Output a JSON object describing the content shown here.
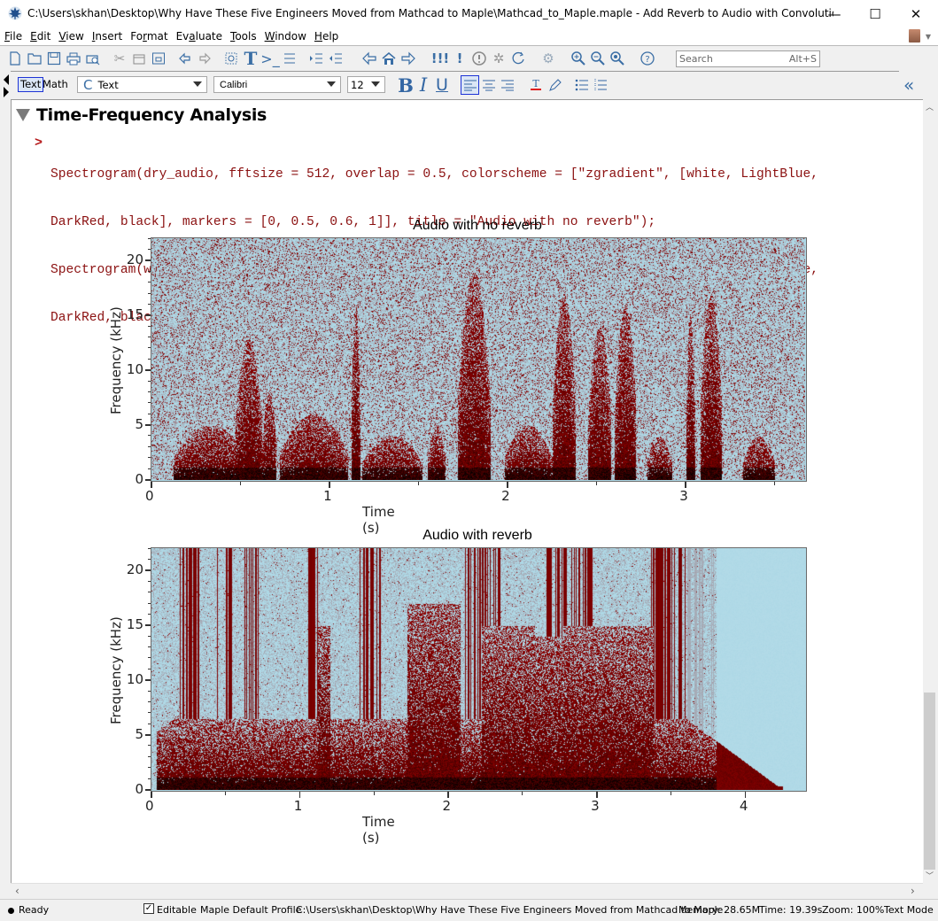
{
  "window": {
    "title": "C:\\Users\\skhan\\Desktop\\Why Have These Five Engineers Moved from Mathcad to Maple\\Mathcad_to_Maple.maple - Add Reverb to Audio with Convolution* - [Server...",
    "minimize": "—",
    "maximize": "☐",
    "close": "✕"
  },
  "menu": [
    {
      "label": "File",
      "mnemonic": "F",
      "rest": "ile"
    },
    {
      "label": "Edit",
      "mnemonic": "E",
      "rest": "dit"
    },
    {
      "label": "View",
      "mnemonic": "V",
      "rest": "iew"
    },
    {
      "label": "Insert",
      "mnemonic": "I",
      "rest": "nsert"
    },
    {
      "label": "Format",
      "pre": "Fo",
      "mnemonic": "r",
      "rest": "mat"
    },
    {
      "label": "Evaluate",
      "pre": "Ev",
      "mnemonic": "a",
      "rest": "luate"
    },
    {
      "label": "Tools",
      "mnemonic": "T",
      "rest": "ools"
    },
    {
      "label": "Window",
      "mnemonic": "W",
      "rest": "indow"
    },
    {
      "label": "Help",
      "mnemonic": "H",
      "rest": "elp"
    }
  ],
  "toolbar": {
    "search_placeholder": "Search",
    "search_shortcut": "Alt+S",
    "icons": [
      "new-document-icon",
      "open-folder-icon",
      "save-icon",
      "print-icon",
      "print-preview-icon",
      "cut-icon",
      "copy-icon",
      "paste-icon",
      "undo-icon",
      "redo-icon",
      "insert-math-icon",
      "insert-text-icon",
      "insert-prompt-icon",
      "insert-paragraph-icon",
      "indent-icon",
      "outdent-icon",
      "back-icon",
      "home-icon",
      "forward-icon",
      "execute-all-icon",
      "execute-icon",
      "interrupt-icon",
      "debug-icon",
      "restart-icon",
      "connect-icon",
      "zoom-in-icon",
      "zoom-out-icon",
      "zoom-fit-icon",
      "help-icon"
    ]
  },
  "format_bar": {
    "mode_text": "Text",
    "mode_math": "Math",
    "style_icon": "C",
    "style_value": "Text",
    "font_value": "Calibri",
    "size_value": "12",
    "bold": "B",
    "italic": "I",
    "underline": "U",
    "collapse": "«"
  },
  "document": {
    "section_title": "Time-Frequency Analysis",
    "prompt": ">",
    "code_lines": [
      "Spectrogram(dry_audio, fftsize = 512, overlap = 0.5, colorscheme = [\"zgradient\", [white, LightBlue,",
      "DarkRed, black], markers = [0, 0.5, 0.6, 1]], title = \"Audio with no reverb\");",
      "Spectrogram(wet_audio, fftsize = 512, overlap = 0.5, colorscheme = [\"zgradient\", [white, LightBlue,",
      "DarkRed, black], markers = [0, 0.5, 0.6, 1]], title = \"Audio with reverb\");"
    ]
  },
  "chart_data": [
    {
      "type": "heatmap",
      "title": "Audio with no reverb",
      "xlabel": "Time (s)",
      "ylabel": "Frequency (kHz)",
      "xlim": [
        0,
        3.67
      ],
      "ylim": [
        0,
        22.05
      ],
      "xticks": [
        0,
        1,
        2,
        3
      ],
      "yticks": [
        0,
        5,
        10,
        15,
        20
      ],
      "colorscheme": {
        "colors": [
          "#ffffff",
          "#add8e6",
          "#8b0000",
          "#000000"
        ],
        "markers": [
          0,
          0.5,
          0.6,
          1
        ]
      },
      "events": [
        {
          "t": [
            0.12,
            0.55
          ],
          "fmax": 5
        },
        {
          "t": [
            0.47,
            0.62
          ],
          "fmax": 13
        },
        {
          "t": [
            0.62,
            0.7
          ],
          "fmax": 8
        },
        {
          "t": [
            0.72,
            1.1
          ],
          "fmax": 6
        },
        {
          "t": [
            1.12,
            1.17
          ],
          "fmax": 16
        },
        {
          "t": [
            1.18,
            1.52
          ],
          "fmax": 4
        },
        {
          "t": [
            1.55,
            1.65
          ],
          "fmax": 5
        },
        {
          "t": [
            1.72,
            1.9
          ],
          "fmax": 19
        },
        {
          "t": [
            1.98,
            2.25
          ],
          "fmax": 5
        },
        {
          "t": [
            2.25,
            2.38
          ],
          "fmax": 17
        },
        {
          "t": [
            2.45,
            2.58
          ],
          "fmax": 14
        },
        {
          "t": [
            2.6,
            2.72
          ],
          "fmax": 16
        },
        {
          "t": [
            2.78,
            2.92
          ],
          "fmax": 4
        },
        {
          "t": [
            3.0,
            3.05
          ],
          "fmax": 15
        },
        {
          "t": [
            3.08,
            3.2
          ],
          "fmax": 17
        },
        {
          "t": [
            3.32,
            3.5
          ],
          "fmax": 4
        }
      ]
    },
    {
      "type": "heatmap",
      "title": "Audio with reverb",
      "xlabel": "Time (s)",
      "ylabel": "Frequency (kHz)",
      "xlim": [
        0,
        4.4
      ],
      "ylim": [
        0,
        22.05
      ],
      "xticks": [
        0,
        1,
        2,
        3,
        4
      ],
      "yticks": [
        0,
        5,
        10,
        15,
        20
      ],
      "colorscheme": {
        "colors": [
          "#ffffff",
          "#add8e6",
          "#8b0000",
          "#000000"
        ],
        "markers": [
          0,
          0.5,
          0.6,
          1
        ]
      },
      "decay_end_s": 4.25
    }
  ],
  "status": {
    "state": "Ready",
    "editable_label": "Editable",
    "editable_checked": true,
    "profile": "Maple Default Profile",
    "path": "C:\\Users\\skhan\\Desktop\\Why Have These Five Engineers Moved from Mathcad to Maple",
    "memory": "Memory: 28.65M",
    "time": "Time: 19.39s",
    "zoom": "Zoom: 100%",
    "mode": "Text Mode"
  }
}
